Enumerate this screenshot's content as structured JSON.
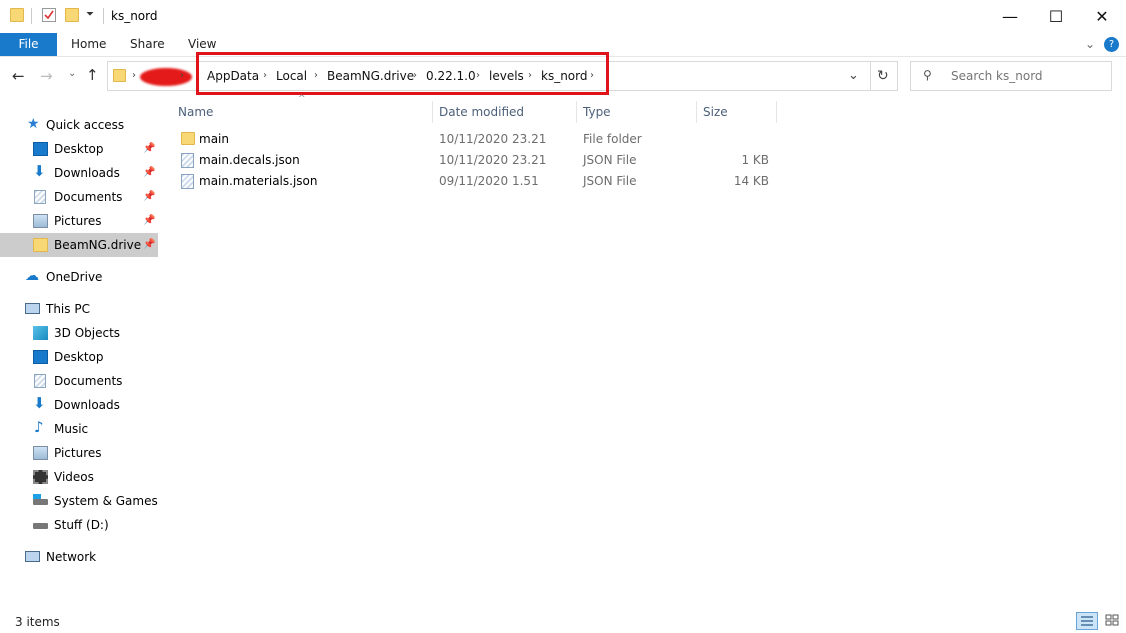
{
  "window": {
    "title": "ks_nord",
    "minimize": "—",
    "maximize": "☐",
    "close": "✕"
  },
  "ribbon": {
    "tabs": [
      "File",
      "Home",
      "Share",
      "View"
    ],
    "collapse": "⌄",
    "help": "?"
  },
  "address": {
    "crumbs": [
      "AppData",
      "Local",
      "BeamNG.drive",
      "0.22.1.0",
      "levels",
      "ks_nord"
    ],
    "dropdown": "⌄",
    "refresh": "↻"
  },
  "search": {
    "placeholder": "Search ks_nord"
  },
  "sidebar": {
    "quick_access": "Quick access",
    "quick_items": [
      "Desktop",
      "Downloads",
      "Documents",
      "Pictures",
      "BeamNG.drive"
    ],
    "onedrive": "OneDrive",
    "this_pc": "This PC",
    "pc_items": [
      "3D Objects",
      "Desktop",
      "Documents",
      "Downloads",
      "Music",
      "Pictures",
      "Videos",
      "System & Games (C",
      "Stuff (D:)"
    ],
    "network": "Network"
  },
  "columns": {
    "name": "Name",
    "date": "Date modified",
    "type": "Type",
    "size": "Size"
  },
  "files": [
    {
      "name": "main",
      "date": "10/11/2020 23.21",
      "type": "File folder",
      "size": ""
    },
    {
      "name": "main.decals.json",
      "date": "10/11/2020 23.21",
      "type": "JSON File",
      "size": "1 KB"
    },
    {
      "name": "main.materials.json",
      "date": "09/11/2020 1.51",
      "type": "JSON File",
      "size": "14 KB"
    }
  ],
  "status": {
    "count": "3 items"
  },
  "colors": {
    "accent": "#1979ca",
    "highlight": "#e0131b",
    "folder": "#f8d775"
  }
}
